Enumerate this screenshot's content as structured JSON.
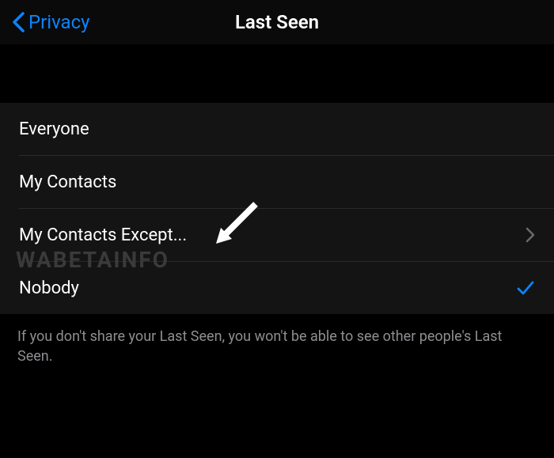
{
  "nav": {
    "back_label": "Privacy",
    "title": "Last Seen"
  },
  "options": {
    "everyone": "Everyone",
    "my_contacts": "My Contacts",
    "my_contacts_except": "My Contacts Except...",
    "nobody": "Nobody"
  },
  "selected": "nobody",
  "footer": "If you don't share your Last Seen, you won't be able to see other people's Last Seen.",
  "watermark": "WABETAINFO"
}
